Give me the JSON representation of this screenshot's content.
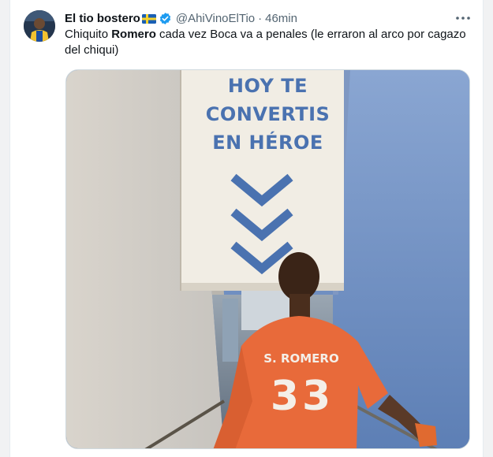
{
  "tweet": {
    "author_name": "El tio bostero",
    "handle": "@AhiVinoElTio",
    "separator": "·",
    "time": "46min",
    "text_before": "Chiquito ",
    "text_bold": "Romero",
    "text_after": " cada vez Boca va a penales (le erraron al arco por cagazo del chiqui)"
  },
  "icons": {
    "flag": "sweden-flag-icon",
    "verified": "verified-badge-icon",
    "more": "more-options-icon"
  },
  "media": {
    "sign_line1": "HOY TE",
    "sign_line2": "CONVERTIS",
    "sign_line3": "EN HÉROE",
    "shirt_name": "S. ROMERO",
    "shirt_number": "33"
  },
  "colors": {
    "verified_blue": "#1d9bf0",
    "sign_blue": "#4a72b0",
    "shirt_orange": "#e86a3a"
  }
}
